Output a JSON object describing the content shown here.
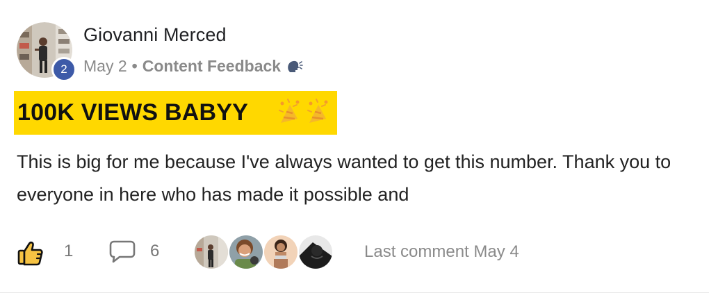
{
  "post": {
    "author": "Giovanni Merced",
    "level": "2",
    "date": "May 2",
    "separator": "•",
    "category": "Content Feedback",
    "category_icon": "speaking-head-icon",
    "title": "100K VIEWS BABYY",
    "title_emoji": "party-popper-icon",
    "body": "This is big for me because I've always wanted to get this number. Thank you to everyone in here who has made it possible and",
    "highlight_color": "#ffd800"
  },
  "footer": {
    "like_icon": "thumbs-up-icon",
    "like_count": "1",
    "comment_icon": "comment-bubble-icon",
    "comment_count": "6",
    "last_comment": "Last comment May 4",
    "commenters": [
      "commenter-avatar-1",
      "commenter-avatar-2",
      "commenter-avatar-3",
      "commenter-avatar-4"
    ]
  },
  "colors": {
    "level_badge": "#3d5aa8",
    "like_icon_fill": "#f6c343",
    "muted_text": "#8a8a8a"
  }
}
